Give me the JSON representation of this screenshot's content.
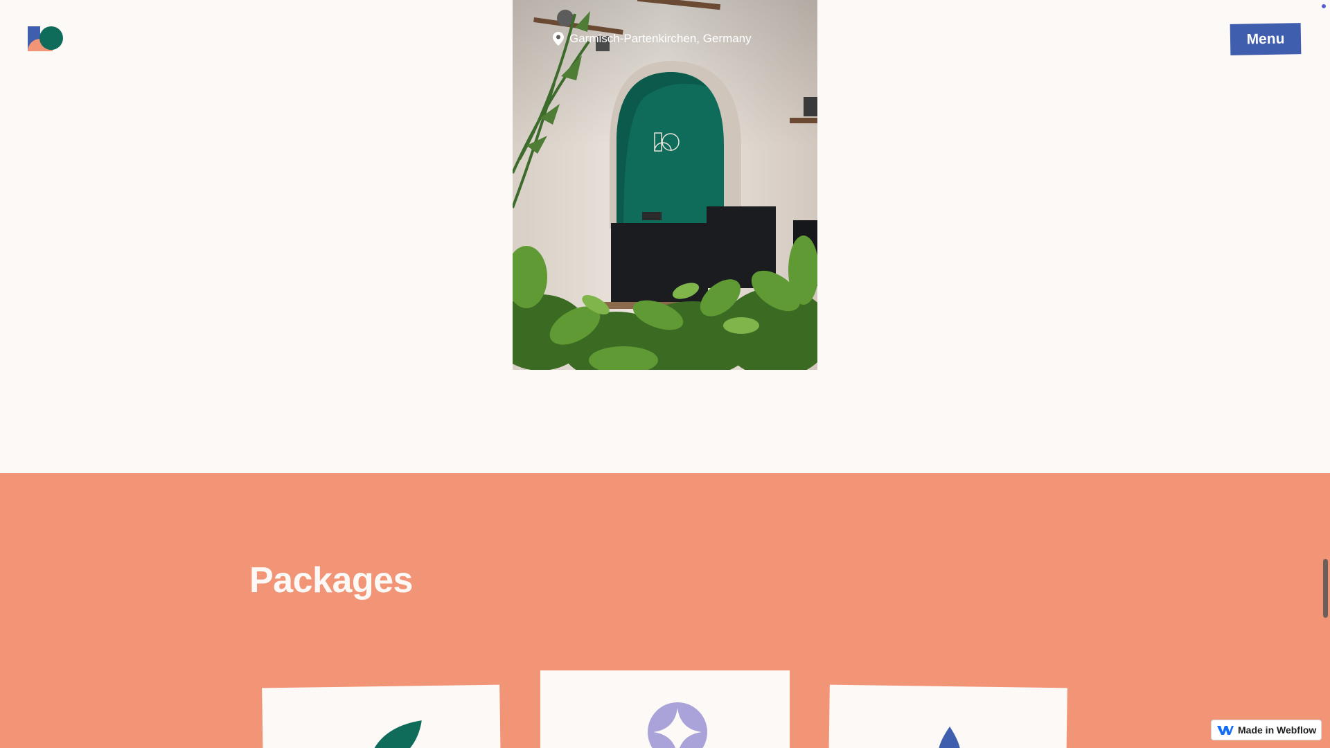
{
  "header": {
    "logo_icon": "studio-logo-icon",
    "menu_label": "Menu"
  },
  "hero": {
    "location_icon": "map-pin-icon",
    "location": "Garmisch-Partenkirchen, Germany"
  },
  "packages": {
    "title": "Packages",
    "cards": [
      {
        "icon": "leaf-icon",
        "color": "#0f6b5a"
      },
      {
        "icon": "sparkle-icon",
        "color": "#a9a3d9"
      },
      {
        "icon": "drop-icon",
        "color": "#3f5fae"
      }
    ]
  },
  "badge": {
    "icon": "webflow-logo-icon",
    "label": "Made in Webflow"
  },
  "colors": {
    "page_background": "#fcf9f6",
    "packages_background": "#f29476",
    "menu_button": "#3f5fae",
    "wall_green": "#0f6b5a"
  }
}
